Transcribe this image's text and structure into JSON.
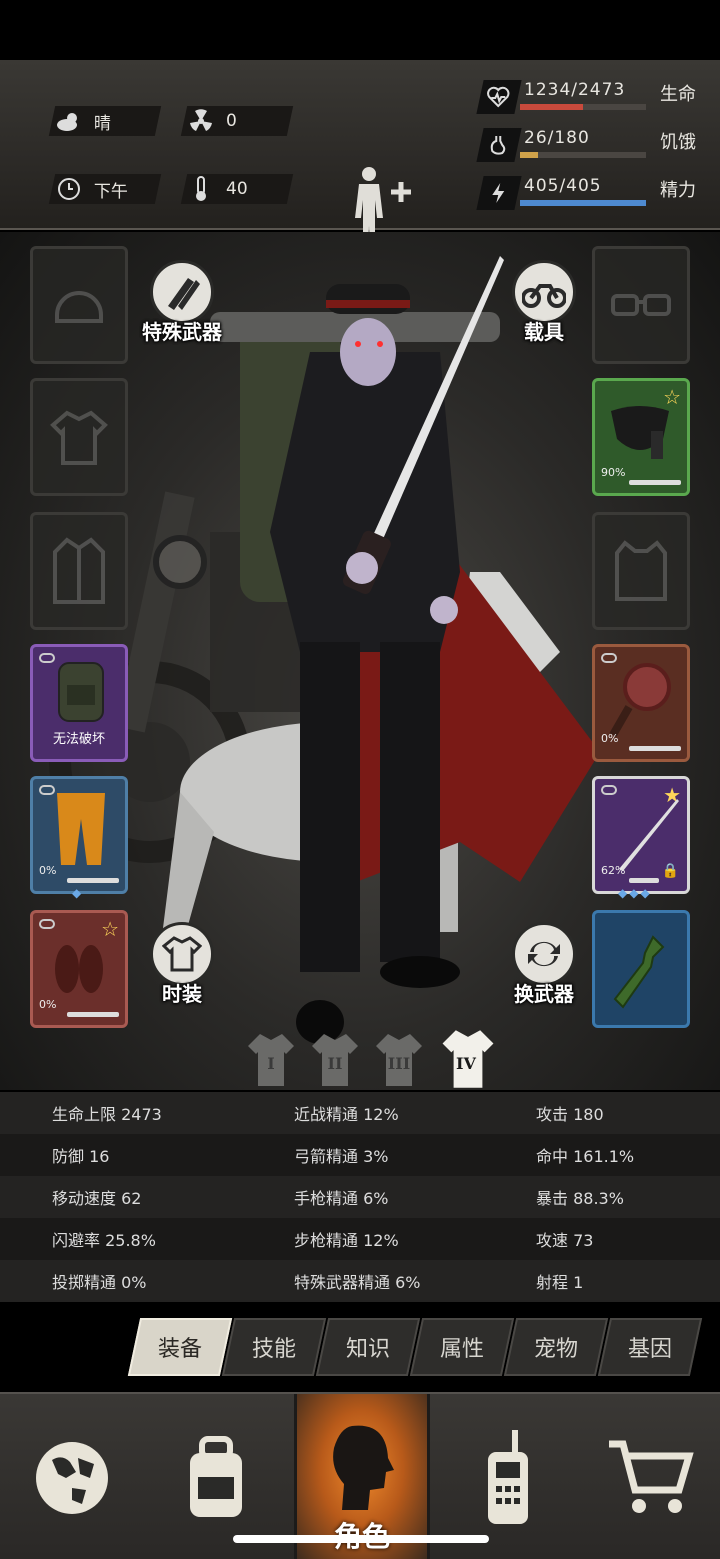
{
  "status": {
    "weather": "晴",
    "radiation": "0",
    "time_of_day": "下午",
    "temperature": "40"
  },
  "vitals": [
    {
      "value": "1234/2473",
      "label": "生命",
      "icon": "heart-icon",
      "fraction": 0.5,
      "color": "#c94a3c"
    },
    {
      "value": "26/180",
      "label": "饥饿",
      "icon": "stomach-icon",
      "fraction": 0.14,
      "color": "#d0a24a"
    },
    {
      "value": "405/405",
      "label": "精力",
      "icon": "energy-icon",
      "fraction": 1.0,
      "color": "#4e8ad0"
    }
  ],
  "buttons": {
    "special_weapon": "特殊武器",
    "vehicle": "载具",
    "fashion": "时装",
    "swap_weapon": "换武器"
  },
  "equipment": {
    "backpack_caption": "无法破坏",
    "pants_pct": "0%",
    "shoes_pct": "0%",
    "mask_pct": "90%",
    "pan_pct": "0%",
    "katana_pct": "62%"
  },
  "outfit_tabs": [
    "I",
    "II",
    "III",
    "IV"
  ],
  "attributes": [
    [
      "生命上限 2473",
      "近战精通 12%",
      "攻击 180"
    ],
    [
      "防御 16",
      "弓箭精通 3%",
      "命中 161.1%"
    ],
    [
      "移动速度 62",
      "手枪精通 6%",
      "暴击 88.3%"
    ],
    [
      "闪避率 25.8%",
      "步枪精通 12%",
      "攻速 73"
    ],
    [
      "投掷精通 0%",
      "特殊武器精通 6%",
      "射程 1"
    ]
  ],
  "tabs": [
    "装备",
    "技能",
    "知识",
    "属性",
    "宠物",
    "基因"
  ],
  "nav": {
    "character_label": "角色"
  }
}
